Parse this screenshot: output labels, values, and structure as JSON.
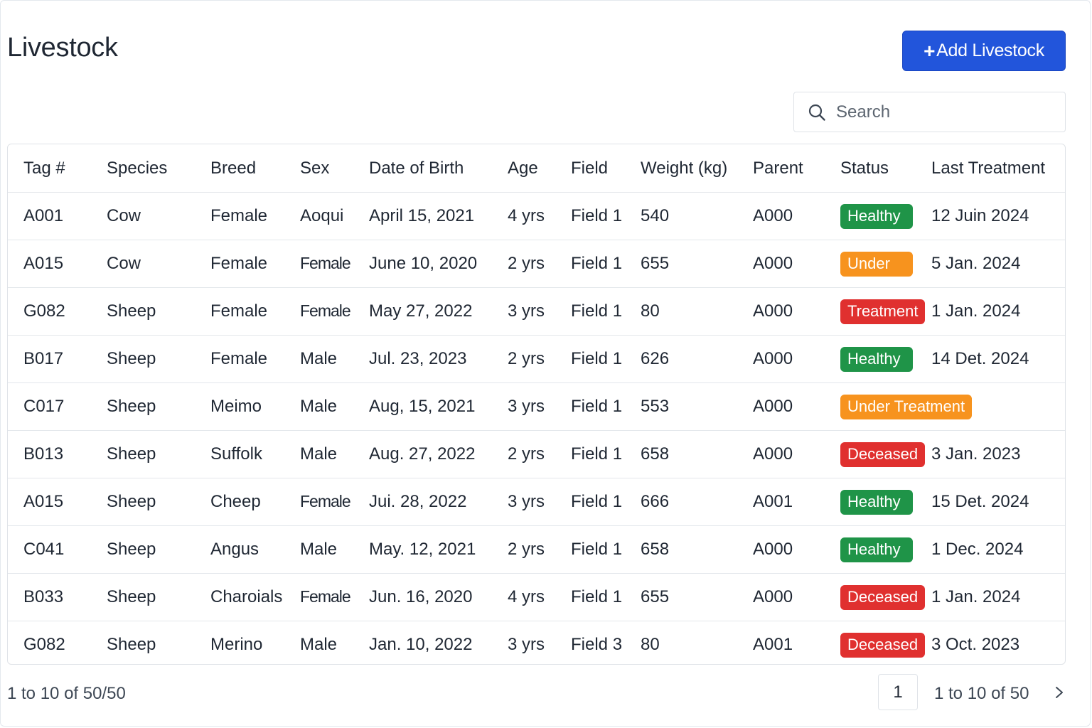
{
  "header": {
    "title": "Livestock",
    "add_button": {
      "plus": "+",
      "label": "Add Livestock"
    }
  },
  "search": {
    "placeholder": "Search"
  },
  "table": {
    "columns": [
      "Tag #",
      "Species",
      "Breed",
      "Sex",
      "Date of Birth",
      "Age",
      "Field",
      "Weight (kg)",
      "Parent",
      "Status",
      "Last Treatment"
    ],
    "rows": [
      {
        "tag": "A001",
        "species": "Cow",
        "breed": "Female",
        "sex": "Aoqui",
        "dob": "April 15, 2021",
        "age": "4 yrs",
        "field": "Field 1",
        "weight": "540",
        "parent": "A000",
        "status": "Healthy",
        "status_type": "healthy",
        "last_treatment": "12 Juin 2024"
      },
      {
        "tag": "A015",
        "species": "Cow",
        "breed": "Female",
        "sex": "Female",
        "dob": "June 10, 2020",
        "age": "2 yrs",
        "field": "Field 1",
        "weight": "655",
        "parent": "A000",
        "status": "Under",
        "status_type": "under",
        "last_treatment": "5 Jan. 2024"
      },
      {
        "tag": "G082",
        "species": "Sheep",
        "breed": "Female",
        "sex": "Female",
        "dob": "May 27, 2022",
        "age": "3 yrs",
        "field": "Field 1",
        "weight": "80",
        "parent": "A000",
        "status": "Treatment",
        "status_type": "treatment",
        "last_treatment": "1 Jan. 2024"
      },
      {
        "tag": "B017",
        "species": "Sheep",
        "breed": "Female",
        "sex": "Male",
        "dob": "Jul. 23, 2023",
        "age": "2 yrs",
        "field": "Field 1",
        "weight": "626",
        "parent": "A000",
        "status": "Healthy",
        "status_type": "healthy",
        "last_treatment": "14 Det. 2024"
      },
      {
        "tag": "C017",
        "species": "Sheep",
        "breed": "Meimo",
        "sex": "Male",
        "dob": "Aug, 15, 2021",
        "age": "3 yrs",
        "field": "Field 1",
        "weight": "553",
        "parent": "A000",
        "status": "Under Treatment",
        "status_type": "under-treatment",
        "last_treatment": ""
      },
      {
        "tag": "B013",
        "species": "Sheep",
        "breed": "Suffolk",
        "sex": "Male",
        "dob": "Aug. 27, 2022",
        "age": "2 yrs",
        "field": "Field 1",
        "weight": "658",
        "parent": "A000",
        "status": "Deceased",
        "status_type": "deceased",
        "last_treatment": "3 Jan. 2023"
      },
      {
        "tag": "A015",
        "species": "Sheep",
        "breed": "Cheep",
        "sex": "Female",
        "dob": "Jui. 28, 2022",
        "age": "3 yrs",
        "field": "Field 1",
        "weight": "666",
        "parent": "A001",
        "status": "Healthy",
        "status_type": "healthy",
        "last_treatment": "15 Det. 2024"
      },
      {
        "tag": "C041",
        "species": "Sheep",
        "breed": "Angus",
        "sex": "Male",
        "dob": "May. 12, 2021",
        "age": "2 yrs",
        "field": "Field 1",
        "weight": "658",
        "parent": "A000",
        "status": "Healthy",
        "status_type": "healthy",
        "last_treatment": "1 Dec. 2024"
      },
      {
        "tag": "B033",
        "species": "Sheep",
        "breed": "Charoials",
        "sex": "Female",
        "dob": "Jun. 16, 2020",
        "age": "4 yrs",
        "field": "Field 1",
        "weight": "655",
        "parent": "A000",
        "status": "Deceased",
        "status_type": "deceased",
        "last_treatment": "1 Jan. 2024"
      },
      {
        "tag": "G082",
        "species": "Sheep",
        "breed": "Merino",
        "sex": "Male",
        "dob": "Jan. 10, 2022",
        "age": "3 yrs",
        "field": "Field 3",
        "weight": "80",
        "parent": "A001",
        "status": "Deceased",
        "status_type": "deceased",
        "last_treatment": "3 Oct. 2023"
      }
    ]
  },
  "pagination": {
    "summary_left": "1 to 10 of 50/50",
    "current_page": "1",
    "summary_right": "1 to 10 of 50",
    "next_icon": "chevron-right-icon"
  },
  "colors": {
    "primary": "#2255db",
    "healthy": "#1f9448",
    "under": "#f7931e",
    "deceased": "#e0302f"
  }
}
